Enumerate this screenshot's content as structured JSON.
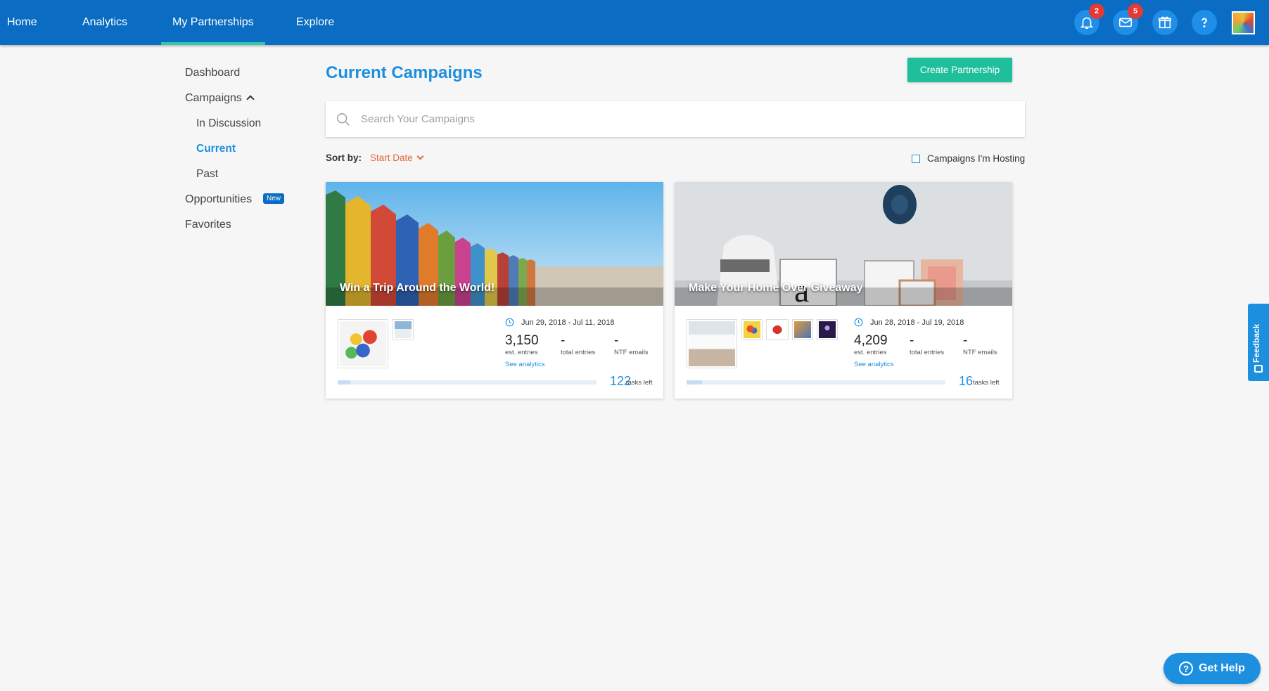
{
  "nav": {
    "tabs": [
      {
        "label": "Home"
      },
      {
        "label": "Analytics"
      },
      {
        "label": "My Partnerships"
      },
      {
        "label": "Explore"
      }
    ],
    "active_tab": "My Partnerships",
    "notifications_count": "2",
    "messages_count": "5",
    "icons": [
      "bell-icon",
      "mail-icon",
      "gift-icon",
      "help-icon"
    ]
  },
  "sidebar": {
    "dashboard": "Dashboard",
    "campaigns": "Campaigns",
    "in_discussion": "In Discussion",
    "current": "Current",
    "past": "Past",
    "opportunities": "Opportunities",
    "opportunities_badge": "New",
    "favorites": "Favorites"
  },
  "main": {
    "title": "Current Campaigns",
    "create_button": "Create Partnership",
    "search_placeholder": "Search Your Campaigns",
    "sort_label": "Sort by:",
    "sort_value": "Start Date",
    "hosting_filter": "Campaigns I'm Hosting"
  },
  "campaigns": [
    {
      "title": "Win a Trip Around the World!",
      "dates": "Jun 29, 2018 - Jul 11, 2018",
      "est_entries": "3,150",
      "est_entries_label": "est. entries",
      "total_entries": "-",
      "total_entries_label": "total entries",
      "ntf_emails": "-",
      "ntf_emails_label": "NTF emails",
      "see_analytics": "See analytics",
      "tasks_left": "122",
      "tasks_left_label": "tasks left",
      "progress_fraction": 0.05
    },
    {
      "title": "Make Your Home Over Giveaway",
      "dates": "Jun 28, 2018 - Jul 19, 2018",
      "est_entries": "4,209",
      "est_entries_label": "est. entries",
      "total_entries": "-",
      "total_entries_label": "total entries",
      "ntf_emails": "-",
      "ntf_emails_label": "NTF emails",
      "see_analytics": "See analytics",
      "tasks_left": "16",
      "tasks_left_label": "tasks left",
      "progress_fraction": 0.06
    }
  ],
  "feedback_label": "Feedback",
  "get_help_label": "Get Help",
  "colors": {
    "nav_bg": "#0a6cc2",
    "accent_blue": "#1d8fdf",
    "accent_green": "#1fbf9b",
    "sort_orange": "#e26a3c",
    "badge_red": "#e53935"
  }
}
